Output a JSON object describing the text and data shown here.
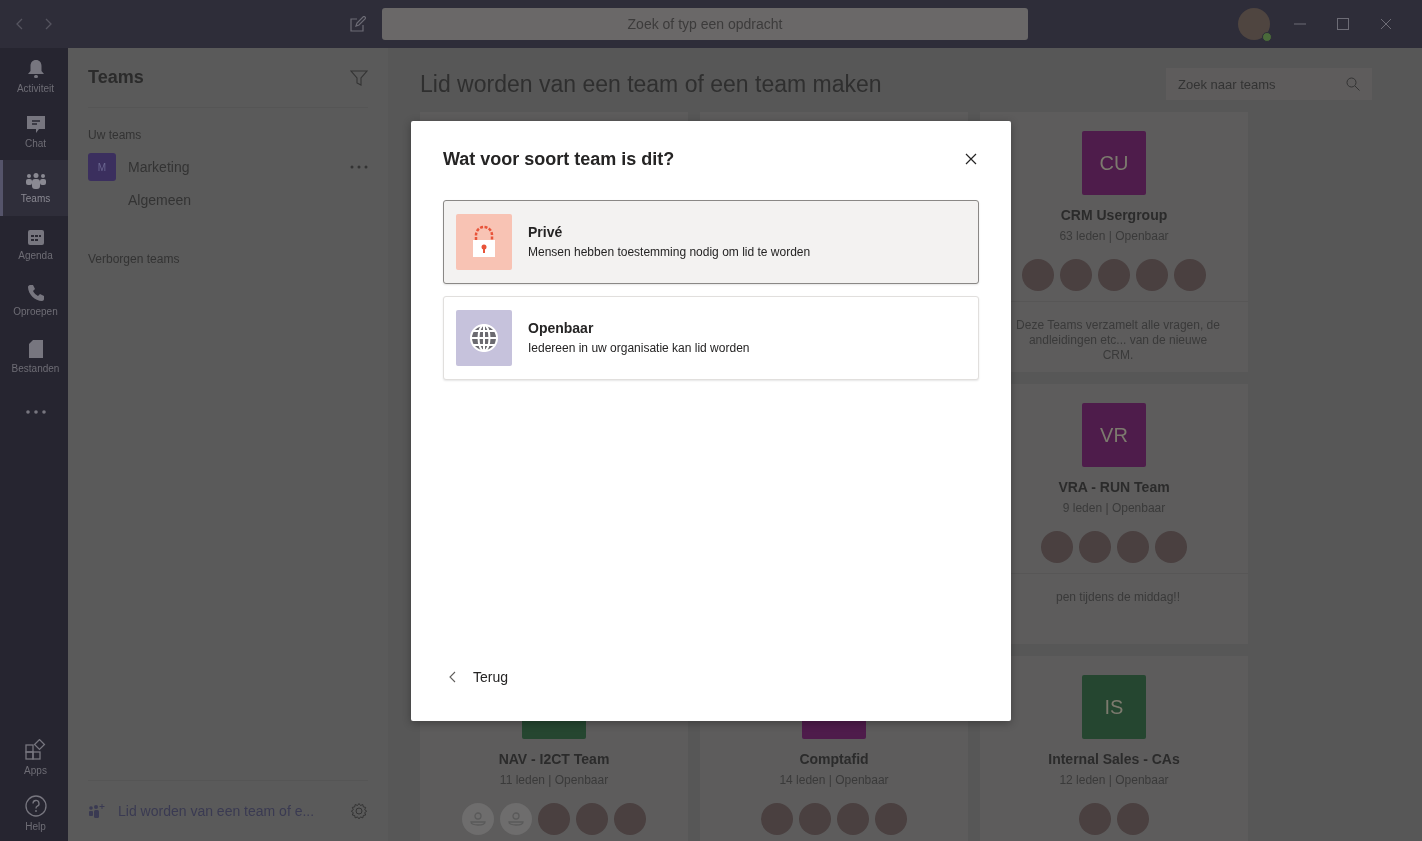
{
  "top_bar": {
    "search": {
      "placeholder": "Zoek of typ een opdracht"
    }
  },
  "rail": {
    "items": [
      {
        "kind": "bell",
        "label": "Activiteit",
        "selected": false
      },
      {
        "kind": "chat",
        "label": "Chat",
        "selected": false
      },
      {
        "kind": "teams",
        "label": "Teams",
        "selected": true
      },
      {
        "kind": "calendar",
        "label": "Agenda",
        "selected": false
      },
      {
        "kind": "phone",
        "label": "Oproepen",
        "selected": false
      },
      {
        "kind": "file",
        "label": "Bestanden",
        "selected": false
      },
      {
        "kind": "more",
        "selected": false
      }
    ],
    "bottom": [
      {
        "kind": "apps",
        "label": "Apps",
        "selected": false
      },
      {
        "kind": "help",
        "label": "Help",
        "selected": false
      }
    ]
  },
  "sidebar": {
    "title": "Teams",
    "sections": [
      {
        "label": "Uw teams",
        "teams": [
          {
            "initial": "M",
            "name": "Marketing",
            "color": "#3b2f5e",
            "channels": [
              "Algemeen"
            ]
          }
        ]
      },
      {
        "label": "Verborgen teams"
      }
    ],
    "footer": {
      "label": "Lid worden van een team of e..."
    }
  },
  "main": {
    "title": "Lid worden van een team of een team maken",
    "search": {
      "placeholder": "Zoek naar teams"
    },
    "cards": [
      {
        "initials": "CU",
        "color": "#4e1c4b",
        "name": "CRM Usergroup",
        "meta": "63 leden | Openbaar",
        "avatars": [
          {
            "kind": "photo"
          },
          {
            "kind": "photo"
          },
          {
            "kind": "photo"
          },
          {
            "kind": "photo"
          },
          {
            "kind": "photo"
          }
        ],
        "description": "Deze Teams verzamelt alle vragen, de andleidingen etc... van de nieuwe CRM."
      },
      {
        "initials": "VR",
        "color": "#4e1c4b",
        "name": "VRA - RUN Team",
        "meta": "9 leden | Openbaar",
        "avatars": [
          {
            "kind": "photo"
          },
          {
            "kind": "photo"
          },
          {
            "kind": "photo"
          },
          {
            "kind": "photo"
          }
        ],
        "description": "pen tijdens de middag!!"
      },
      {
        "color": "#254630",
        "name": "NAV - I2CT Team",
        "meta": "11 leden | Openbaar",
        "avatars": [
          {
            "kind": "placeholder"
          },
          {
            "kind": "placeholder"
          },
          {
            "kind": "photo"
          },
          {
            "kind": "photo"
          },
          {
            "kind": "photo"
          }
        ]
      },
      {
        "color": "#4e1c4b",
        "name": "Comptafid",
        "meta": "14 leden | Openbaar",
        "avatars": [
          {
            "kind": "photo"
          },
          {
            "kind": "photo"
          },
          {
            "kind": "photo"
          },
          {
            "kind": "photo"
          }
        ]
      },
      {
        "initials": "IS",
        "color": "#254630",
        "name": "Internal Sales - CAs",
        "meta": "12 leden | Openbaar",
        "avatars": [
          {
            "kind": "photo"
          },
          {
            "kind": "photo"
          }
        ]
      }
    ]
  },
  "dialog": {
    "title": "Wat voor soort team is dit?",
    "options": [
      {
        "kind": "private",
        "title": "Privé",
        "description": "Mensen hebben toestemming nodig om lid te worden",
        "selected": true
      },
      {
        "kind": "public",
        "title": "Openbaar",
        "description": "Iedereen in uw organisatie kan lid worden",
        "selected": false
      }
    ],
    "back": "Terug"
  }
}
